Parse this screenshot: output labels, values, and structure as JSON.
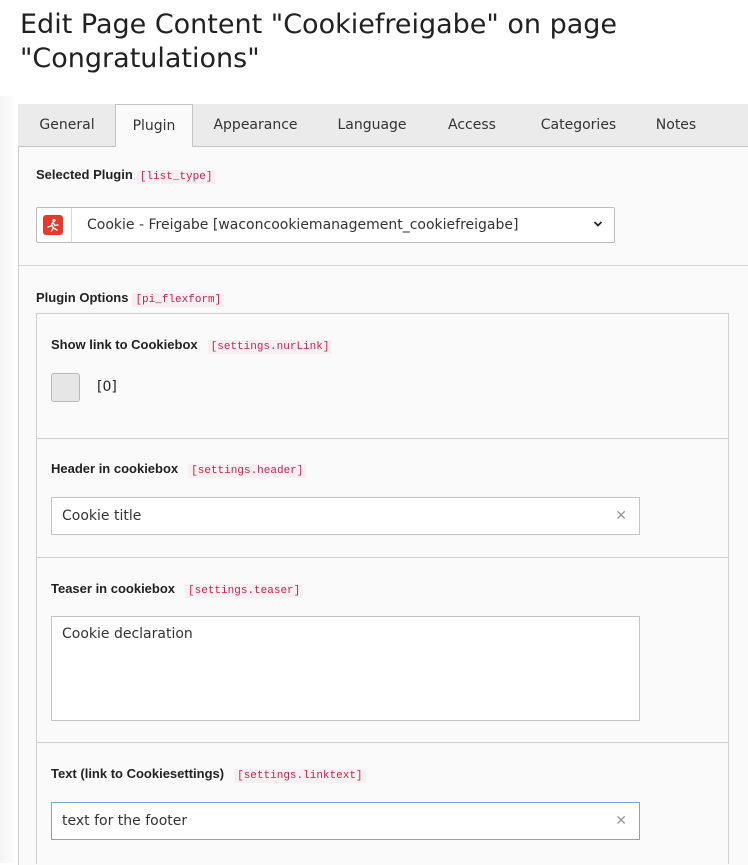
{
  "page": {
    "title": "Edit Page Content \"Cookiefreigabe\" on page \"Congratulations\""
  },
  "tabs": [
    {
      "label": "General"
    },
    {
      "label": "Plugin"
    },
    {
      "label": "Appearance"
    },
    {
      "label": "Language"
    },
    {
      "label": "Access"
    },
    {
      "label": "Categories"
    },
    {
      "label": "Notes"
    }
  ],
  "active_tab": "Plugin",
  "selected_plugin": {
    "label": "Selected Plugin",
    "field": "[list_type]",
    "value": "Cookie - Freigabe [waconcookiemanagement_cookiefreigabe]",
    "icon": "plugin-icon"
  },
  "plugin_options": {
    "label": "Plugin Options",
    "field": "[pi_flexform]",
    "show_link": {
      "label": "Show link to Cookiebox",
      "field": "[settings.nurLink]",
      "value": "[0]"
    },
    "header": {
      "label": "Header in cookiebox",
      "field": "[settings.header]",
      "value": "Cookie title"
    },
    "teaser": {
      "label": "Teaser in cookiebox",
      "field": "[settings.teaser]",
      "value": "Cookie declaration"
    },
    "linktext": {
      "label": "Text (link to Cookiesettings)",
      "field": "[settings.linktext]",
      "value": "text for the footer"
    }
  },
  "colors": {
    "field_code": "#c7254e",
    "plugin_icon": "#e8392d",
    "focus_border": "#6daae0"
  }
}
